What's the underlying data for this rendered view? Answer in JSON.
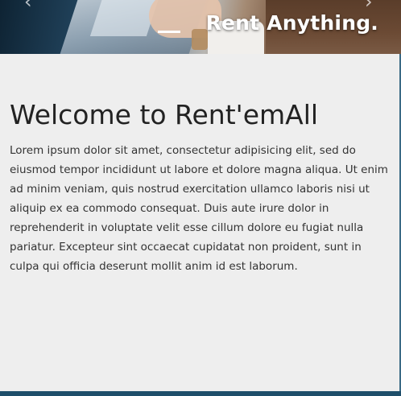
{
  "hero": {
    "tagline": "Rent Anything.",
    "prev_arrow": "‹",
    "next_arrow": "›"
  },
  "main": {
    "title": "Welcome to Rent'emAll",
    "body": "Lorem ipsum dolor sit amet, consectetur adipisicing elit, sed do eiusmod tempor incididunt ut labore et dolore magna aliqua. Ut enim ad minim veniam, quis nostrud exercitation ullamco laboris nisi ut aliquip ex ea commodo consequat. Duis aute irure dolor in reprehenderit in voluptate velit esse cillum dolore eu fugiat nulla pariatur. Excepteur sint occaecat cupidatat non proident, sunt in culpa qui officia deserunt mollit anim id est laborum."
  },
  "colors": {
    "background": "#eeeeee",
    "text": "#222222",
    "footer": "#1e4e6a"
  }
}
